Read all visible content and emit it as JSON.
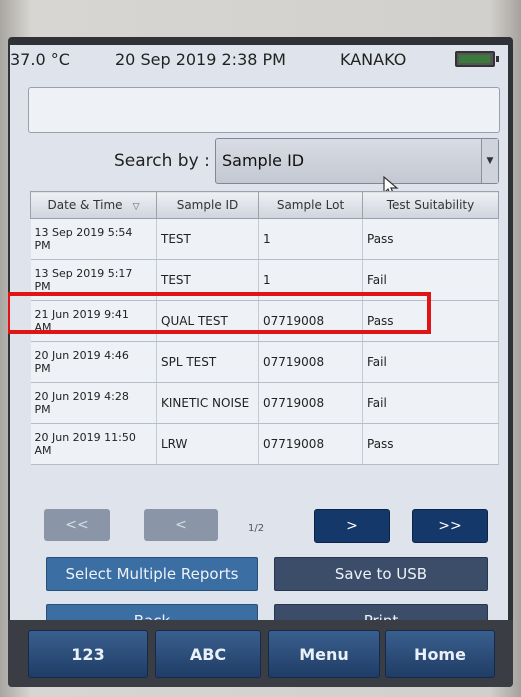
{
  "status": {
    "temperature": "37.0 °C",
    "datetime": "20 Sep 2019 2:38 PM",
    "user": "KANAKO",
    "battery_icon": "battery-icon"
  },
  "search": {
    "text_value": "",
    "label": "Search by :",
    "selected": "Sample ID"
  },
  "table": {
    "headers": [
      "Date & Time",
      "Sample ID",
      "Sample Lot",
      "Test Suitability"
    ],
    "rows": [
      {
        "date1": "13 Sep 2019 5:54",
        "date2": "PM",
        "sample_id": "TEST",
        "lot": "1",
        "result": "Pass"
      },
      {
        "date1": "13 Sep 2019 5:17",
        "date2": "PM",
        "sample_id": "TEST",
        "lot": "1",
        "result": "Fail"
      },
      {
        "date1": "21 Jun 2019 9:41",
        "date2": "AM",
        "sample_id": "QUAL TEST",
        "lot": "07719008",
        "result": "Pass"
      },
      {
        "date1": "20 Jun 2019 4:46",
        "date2": "PM",
        "sample_id": "SPL TEST",
        "lot": "07719008",
        "result": "Fail"
      },
      {
        "date1": "20 Jun 2019 4:28",
        "date2": "PM",
        "sample_id": "KINETIC NOISE",
        "lot": "07719008",
        "result": "Fail"
      },
      {
        "date1": "20 Jun 2019 11:50",
        "date2": "AM",
        "sample_id": "LRW",
        "lot": "07719008",
        "result": "Pass"
      }
    ]
  },
  "pager": {
    "first": "<<",
    "prev": "<",
    "page": "1/2",
    "next": ">",
    "last": ">>"
  },
  "actions": {
    "select_multiple": "Select Multiple Reports",
    "save_usb": "Save to USB",
    "back": "Back",
    "print": "Print"
  },
  "nav": {
    "num": "123",
    "abc": "ABC",
    "menu": "Menu",
    "home": "Home"
  },
  "colors": {
    "highlight": "#e01414",
    "accent": "#14386a"
  }
}
